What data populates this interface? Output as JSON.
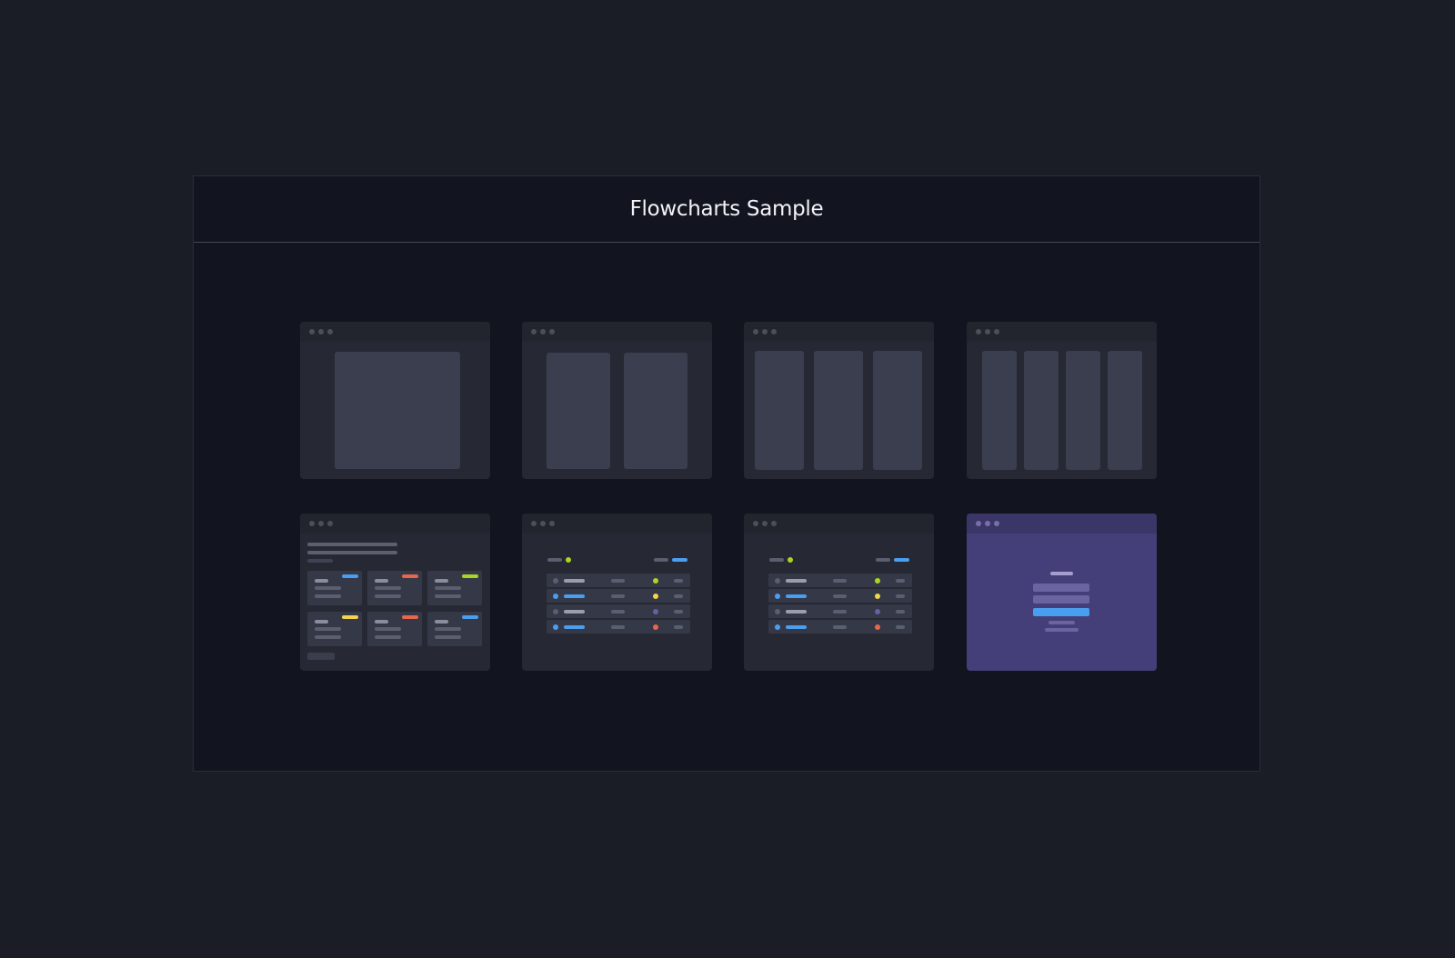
{
  "page": {
    "title": "Flowcharts Sample"
  },
  "thumbnails": [
    {
      "name": "layout-1-column"
    },
    {
      "name": "layout-2-columns"
    },
    {
      "name": "layout-3-columns"
    },
    {
      "name": "layout-4-columns"
    },
    {
      "name": "layout-card-grid"
    },
    {
      "name": "layout-table-list"
    },
    {
      "name": "layout-table-list-alt"
    },
    {
      "name": "layout-login-form"
    }
  ],
  "colors": {
    "background": "#1b1d26",
    "canvas": "#121420",
    "thumb": "#262833",
    "block": "#3a3e4f",
    "blue": "#4a9ef0",
    "red": "#e8664c",
    "lime": "#a8d622",
    "yellow": "#f2d34a",
    "purple": "#443f78",
    "violet": "#6a5ea8"
  }
}
